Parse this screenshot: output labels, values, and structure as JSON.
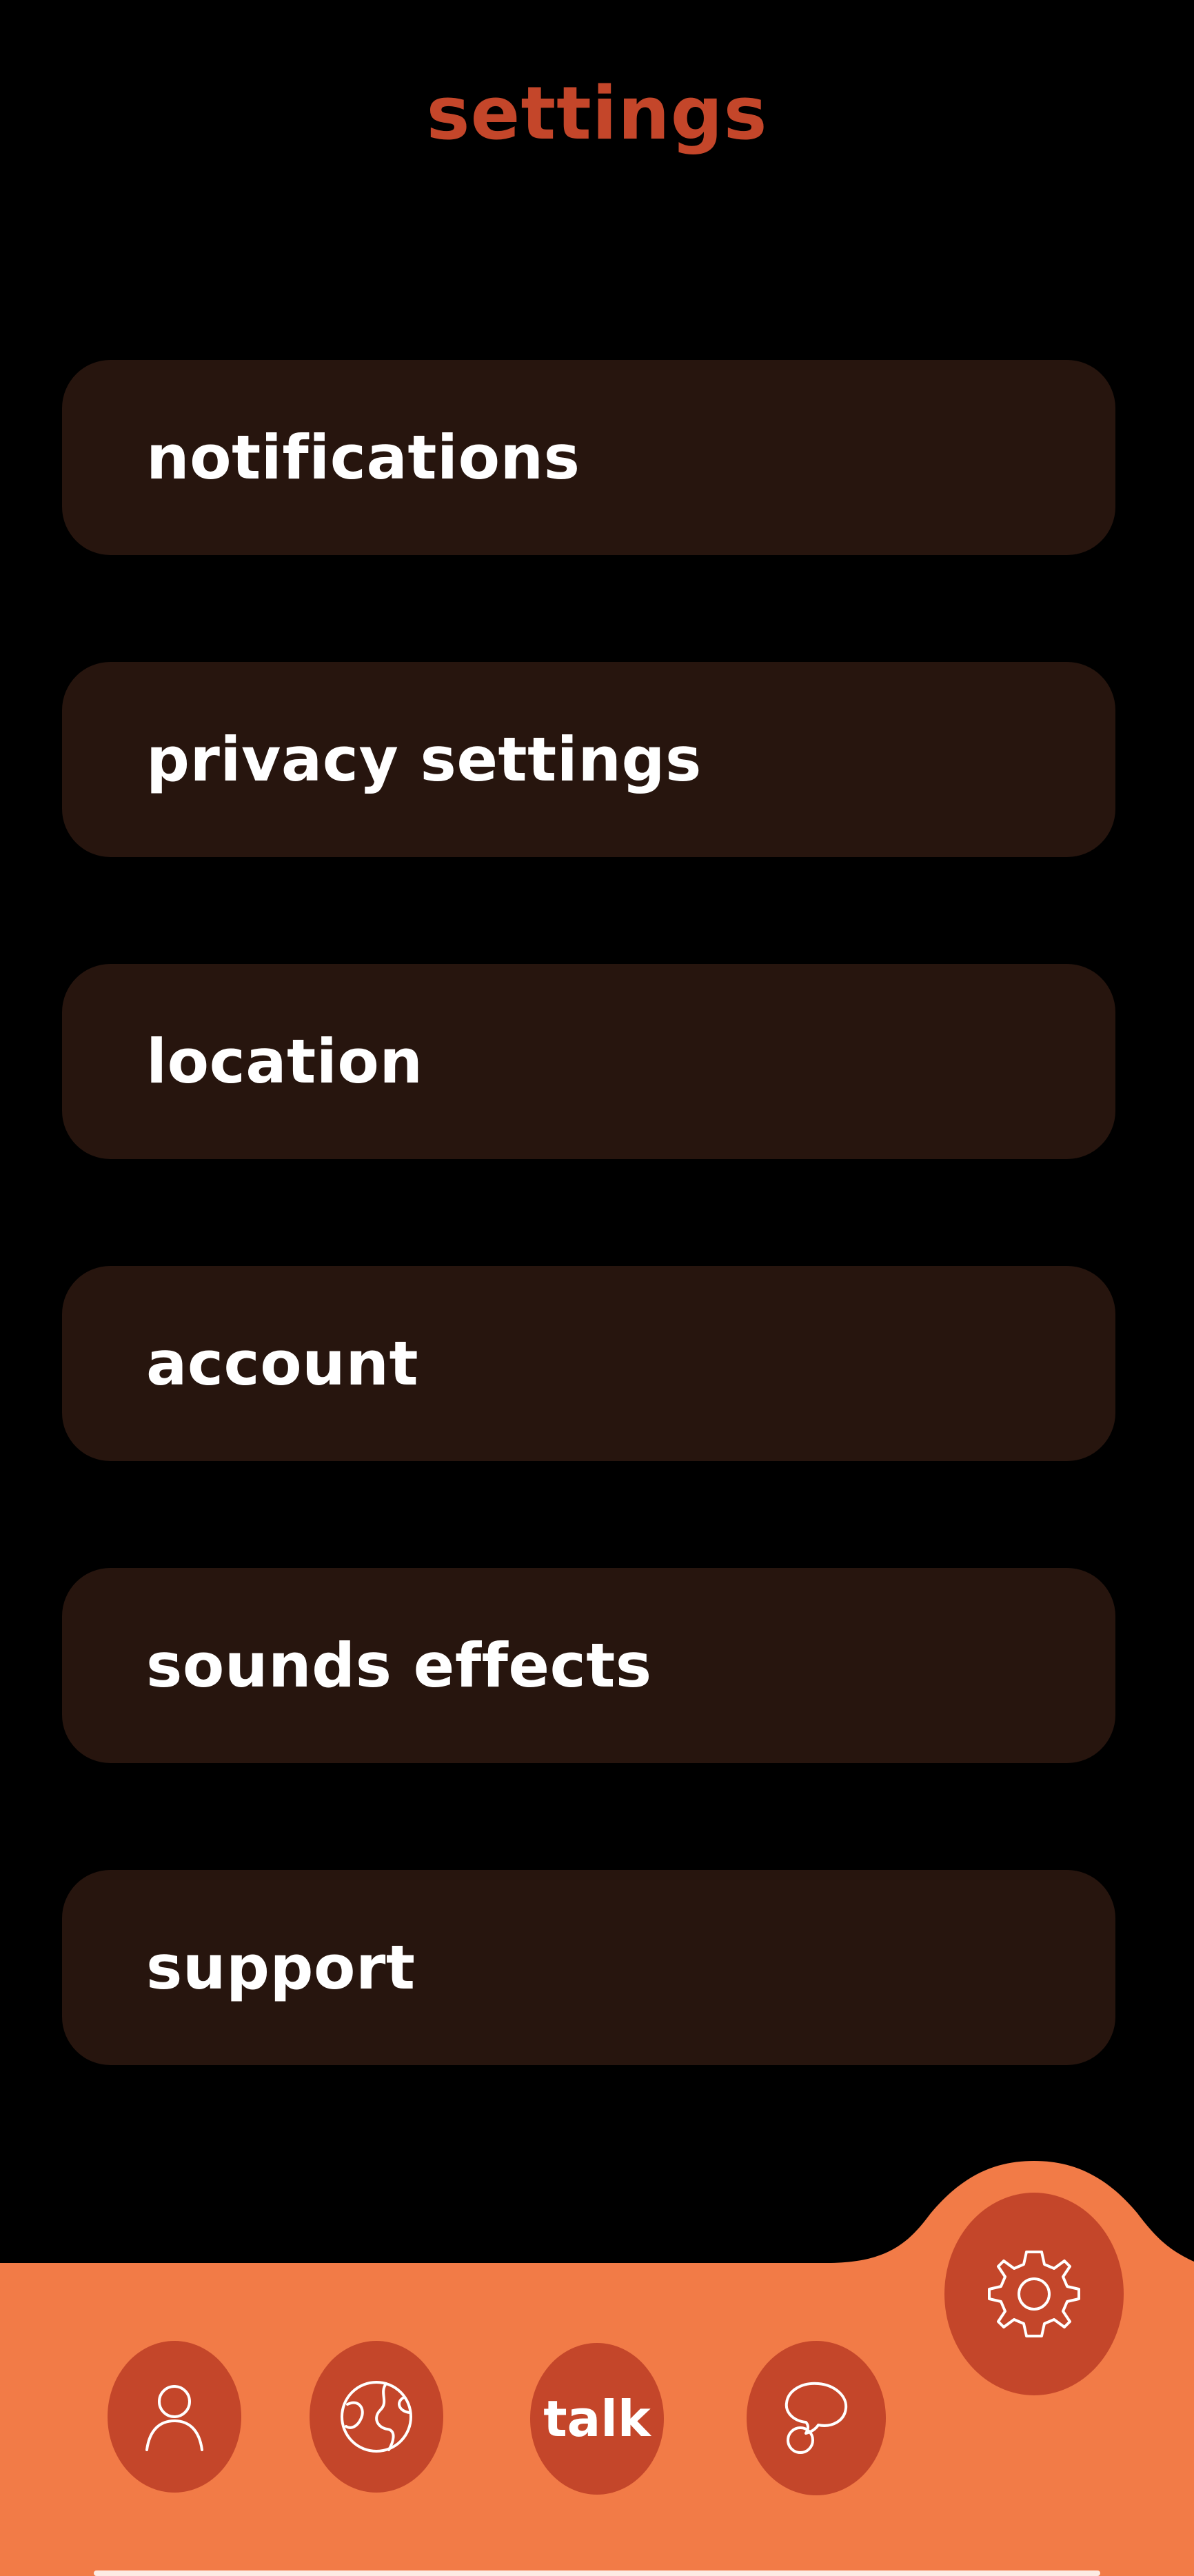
{
  "colors": {
    "background": "#000000",
    "title": "#c4462a",
    "item_background": "#27150e",
    "item_text": "#ffffff",
    "nav_background": "#f27b47",
    "nav_button": "#c4462a",
    "icon_stroke": "#ffffff"
  },
  "header": {
    "title": "settings"
  },
  "settings": {
    "items": [
      {
        "label": "notifications"
      },
      {
        "label": "privacy settings"
      },
      {
        "label": "location"
      },
      {
        "label": "account"
      },
      {
        "label": "sounds effects"
      },
      {
        "label": "support"
      }
    ]
  },
  "nav": {
    "items": [
      {
        "icon": "person-icon",
        "active": false
      },
      {
        "icon": "globe-icon",
        "active": false
      },
      {
        "label": "talk",
        "active": false
      },
      {
        "icon": "chat-bubbles-icon",
        "active": false
      },
      {
        "icon": "gear-icon",
        "active": true
      }
    ]
  }
}
